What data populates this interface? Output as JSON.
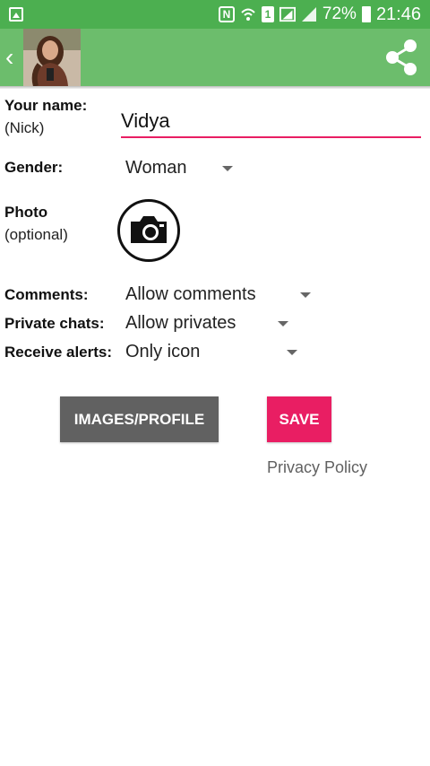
{
  "status_bar": {
    "battery_percent": "72%",
    "time": "21:46",
    "sim_label": "1",
    "icons": [
      "gallery-icon",
      "nfc-icon",
      "wifi-icon",
      "sim-icon",
      "signal-icon",
      "signal-icon",
      "battery-icon"
    ]
  },
  "app_bar": {
    "back_icon": "chevron-left-icon",
    "avatar": "profile-photo",
    "share_icon": "share-icon",
    "color": "#6cbd6c"
  },
  "form": {
    "name": {
      "label": "Your name:",
      "sublabel": "(Nick)",
      "value": "Vidya"
    },
    "gender": {
      "label": "Gender:",
      "value": "Woman"
    },
    "photo": {
      "label": "Photo",
      "sublabel": "(optional)",
      "icon": "camera-icon"
    },
    "comments": {
      "label": "Comments:",
      "value": "Allow comments"
    },
    "private_chats": {
      "label": "Private chats:",
      "value": "Allow privates"
    },
    "alerts": {
      "label": "Receive alerts:",
      "value": "Only icon"
    }
  },
  "actions": {
    "images_profile": "IMAGES/PROFILE",
    "save": "SAVE",
    "privacy_policy": "Privacy Policy"
  },
  "colors": {
    "status_bar": "#4caf50",
    "accent": "#e91e63",
    "secondary_button": "#616161"
  }
}
